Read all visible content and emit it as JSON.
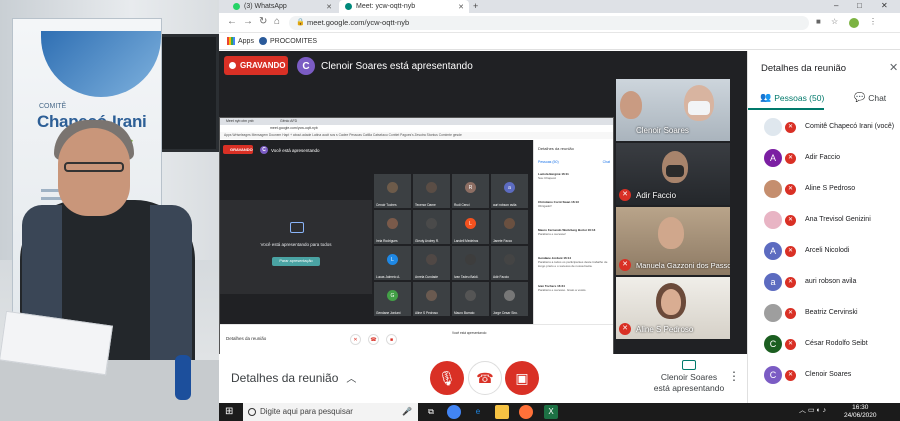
{
  "browser": {
    "tabs": [
      {
        "label": "(3) WhatsApp",
        "color": "#25d366"
      },
      {
        "label": "Meet: ycw-oqtt-nyb",
        "color": "#00897b"
      }
    ],
    "window_controls": [
      "–",
      "□",
      "✕"
    ],
    "url": "meet.google.com/ycw-oqtt-nyb",
    "bookmarks": [
      "Apps",
      "PROCOMITES"
    ]
  },
  "meet": {
    "recording_label": "GRAVANDO",
    "presenter_initial": "C",
    "presenting_text": "Clenoir Soares está apresentando",
    "shared_screen": {
      "tabs": [
        "Meet nyb ctm ynb",
        "Gênio AFD"
      ],
      "url": "meet.google.com/ycw-oqtt-nyb",
      "bookmarks": "Apps  Wrtseleages  Mensagem Dounem  Hapt + about.adade  Latina aucit sos s  Cadee Pessoas  Catilla Catselaou  Conttet Pagoes's   Zesutra Stontus   Comimte gesde",
      "rec": "GRAVANDO",
      "presenting": "Você está apresentando",
      "present_text": "Você está apresentando para todos",
      "stop_label": "Parar apresentação",
      "tiles": [
        {
          "name": "Cenoir Tuches",
          "initial": "",
          "color": "#6d5b4a"
        },
        {
          "name": "Tecenor Dame",
          "initial": "",
          "color": "#5a4d45"
        },
        {
          "name": "Rudi Cenci",
          "initial": "R",
          "color": "#8d6e63"
        },
        {
          "name": "auri robson avila",
          "initial": "a",
          "color": "#5c6bc0"
        },
        {
          "name": "Ireia Rodrigues",
          "initial": "",
          "color": "#7a5a4a"
        },
        {
          "name": "Gleuty Andrey R.",
          "initial": "",
          "color": "#4a4a4a"
        },
        {
          "name": "Landell Medeiros",
          "initial": "L",
          "color": "#f4511e"
        },
        {
          "name": "Janete Facco",
          "initial": "",
          "color": "#6a5040"
        },
        {
          "name": "Lucas Jalmeio A.",
          "initial": "L",
          "color": "#1e88e5"
        },
        {
          "name": "Anrela Cundade",
          "initial": "",
          "color": "#504845"
        },
        {
          "name": "Ivan Tadeu Baldi.",
          "initial": "",
          "color": "#3d3d3d"
        },
        {
          "name": "Adir Faccio",
          "initial": "",
          "color": "#444"
        },
        {
          "name": "Gendane Jordani",
          "initial": "G",
          "color": "#43a047"
        },
        {
          "name": "Aline S Pedroso",
          "initial": "",
          "color": "#6a5a50"
        },
        {
          "name": "Mauro Barrato",
          "initial": "",
          "color": "#555"
        },
        {
          "name": "Jorge Cesar Siro.",
          "initial": "",
          "color": "#777"
        }
      ],
      "panel_title": "Detalhes da reunião",
      "panel_tabs": [
        "Pessoas (50)",
        "Chat"
      ],
      "messages": [
        {
          "author": "Luciola Bergmé 16:11",
          "text": "Sou Chapecó"
        },
        {
          "author": "Christiano Cornt Swan 16:13",
          "text": "Obrigado!!"
        },
        {
          "author": "Mauro Fernando Wurtzberg Bortoi 16:13",
          "text": "Parabéns e sucesso!"
        },
        {
          "author": "Gendane Jordani 16:14",
          "text": "Parabéns a todos os participantes deste trabalho de longo prazo e o sucesso de nossa bacia."
        },
        {
          "author": "Ivan Tochers 16:24",
          "text": "Parabéns e sucesso. Grato a vocês."
        }
      ],
      "bottom_label": "Detalhes da reunião",
      "bottom_presenter": "Você está apresentando"
    },
    "participants_video": [
      {
        "name": "Clenoir Soares"
      },
      {
        "name": "Adir Faccio"
      },
      {
        "name": "Manuela Gazzoni dos Passos"
      },
      {
        "name": "Aline S Pedroso"
      }
    ],
    "controls": {
      "details_label": "Detalhes da reunião",
      "presenter_line1": "Clenoir Soares",
      "presenter_line2": "está apresentando"
    }
  },
  "side_panel": {
    "title": "Detalhes da reunião",
    "tab_people": "Pessoas (50)",
    "tab_chat": "Chat",
    "people": [
      {
        "initial": "",
        "name": "Comitê Chapecó Irani (você)",
        "color": "#dfe7ee"
      },
      {
        "initial": "A",
        "name": "Adir Faccio",
        "color": "#7b1fa2"
      },
      {
        "initial": "",
        "name": "Aline S Pedroso",
        "color": "#c58e6e"
      },
      {
        "initial": "",
        "name": "Ana Trevisol Genizini",
        "color": "#e8b4c4"
      },
      {
        "initial": "A",
        "name": "Arceli Nicolodi",
        "color": "#5c6bc0"
      },
      {
        "initial": "a",
        "name": "auri robson avila",
        "color": "#5c6bc0"
      },
      {
        "initial": "",
        "name": "Beatriz Cervinski",
        "color": "#9e9e9e"
      },
      {
        "initial": "C",
        "name": "César Rodolfo Seibt",
        "color": "#1b5e20"
      },
      {
        "initial": "C",
        "name": "Clenoir Soares",
        "color": "#7b5cc4"
      }
    ]
  },
  "photo": {
    "banner_small": "COMITÊ",
    "banner_big": "Chapecó-Irani"
  },
  "taskbar": {
    "search_placeholder": "Digite aqui para pesquisar",
    "time": "16:30",
    "date": "24/06/2020"
  }
}
